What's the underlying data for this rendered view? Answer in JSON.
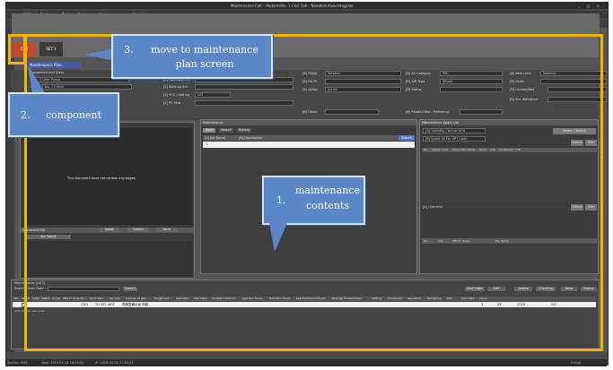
{
  "window": {
    "title": "Maintenance CoK - Hadorm/No. 1 Civil CoK - Nanohim/Hub-Integrate",
    "controls": "_ □ ×"
  },
  "menu": [
    "Home/PMS",
    "Setting",
    "Tool",
    "Spare",
    "Maintenance",
    "設定(系)"
  ],
  "tab": "Maintenance COK",
  "toolbar": {
    "btn1": "COK",
    "btn2": "SET 1"
  },
  "link": "Maintenance Plan",
  "form": {
    "row1": {
      "l1": "Equipment and Class",
      "b1": "No. 1 Gear Pump",
      "l2": "[2] Operation Pt.",
      "l3": "[B] PD(B)",
      "b3": "Rotation",
      "l4": "[B] Air Category",
      "b4": "PRC",
      "l5": "[B] Best Limit",
      "b5": "Nominal"
    },
    "row2": {
      "l1": "EQ",
      "b1": "No. 1 Check",
      "l2": "[2] Starting Sec.",
      "l3": "[B] Dir Pt.",
      "l4": "[B] AIR Type",
      "b4": "Wheel",
      "l5": "[B] Order"
    },
    "row3": {
      "l2": "[2] PCC / Setting",
      "b2": "LAT",
      "l3": "[B] Action",
      "b3": "Active",
      "l4": "[B] Status",
      "l5": "[B] Unclassified"
    },
    "row4": {
      "l2": "[2] PC Mud",
      "l3": "[B] Detail",
      "l4": "[B] Related Dist / Reference",
      "l5": "[B] Ref. Reference"
    }
  },
  "left_panel": {
    "empty_text": "This document does not contain any pages.",
    "sub_header": "Document File",
    "btns": [
      "No. Name",
      "Detail",
      "Delete",
      "Save"
    ]
  },
  "center_panel": {
    "title": "Maintenance",
    "tabs": [
      "Work",
      "Search",
      "History"
    ],
    "col1": "[A] Job Name",
    "col2": "[B] Description",
    "search_btn": "Search",
    "row_id": "1"
  },
  "right_panel": {
    "title": "Maintenance Spare List",
    "field1": "[A] Quantity / Actual Unit",
    "field2": "[B] Spare All For UPT Code",
    "btn_top": "Select / Search",
    "btn_open": "Check",
    "btn_gen": "Gen",
    "cols": [
      "No.",
      "Spare Code",
      "Spare Part Name",
      "Stock",
      "UTS",
      "Consumed",
      "UTS"
    ],
    "checklist": "[A] Checklist",
    "btn_check": "Check",
    "subcols": [
      "No.",
      "LOC",
      "PMS-IF Code",
      "File Name"
    ]
  },
  "bottom_panel": {
    "title": "Maintenance (LIST)",
    "filter_label": "Search Order Date",
    "filter_btn": "Search",
    "btns": [
      "Add Order",
      "Edit",
      "Delete",
      "Checking",
      "Save",
      "Status"
    ],
    "headers": [
      "No.",
      "Select",
      "Code",
      "Status",
      "Group",
      "PMS-IF Code No.",
      "Work Item",
      "Op. Pos.",
      "Interval Of Plan",
      "Equipment",
      "Last Date",
      "Plan Date",
      "Constant Interval",
      "Last Run Hours",
      "Next Run Hours",
      "Last Performed Hours",
      "Next Performed Hours",
      "Setting",
      "Scheduled",
      "Operation",
      "Remaining",
      "PRC",
      "Cost Total",
      "Check"
    ],
    "row": {
      "code": "CDH",
      "pms": "TD 005 WRP",
      "item": "長期整備計画 情報",
      "v1": "3",
      "v2": "29",
      "v3": "2019",
      "v4": "0/0"
    },
    "footer_note": "Click to add new order"
  },
  "status": {
    "left": "Section: PMS",
    "user": "User: 2019-05-24 18:05:30",
    "time": "IP:  2019-05-24 17:55:27",
    "right": "Online"
  },
  "annotations": {
    "c1_num": "1.",
    "c1_text": "maintenance contents",
    "c2_num": "2.",
    "c2_text": "component",
    "c3_num": "3.",
    "c3_text": "move to maintenance plan screen"
  },
  "colors": {
    "highlight": "#f2b400",
    "callout": "#5b87c9",
    "accent_red": "#c04a2a"
  }
}
